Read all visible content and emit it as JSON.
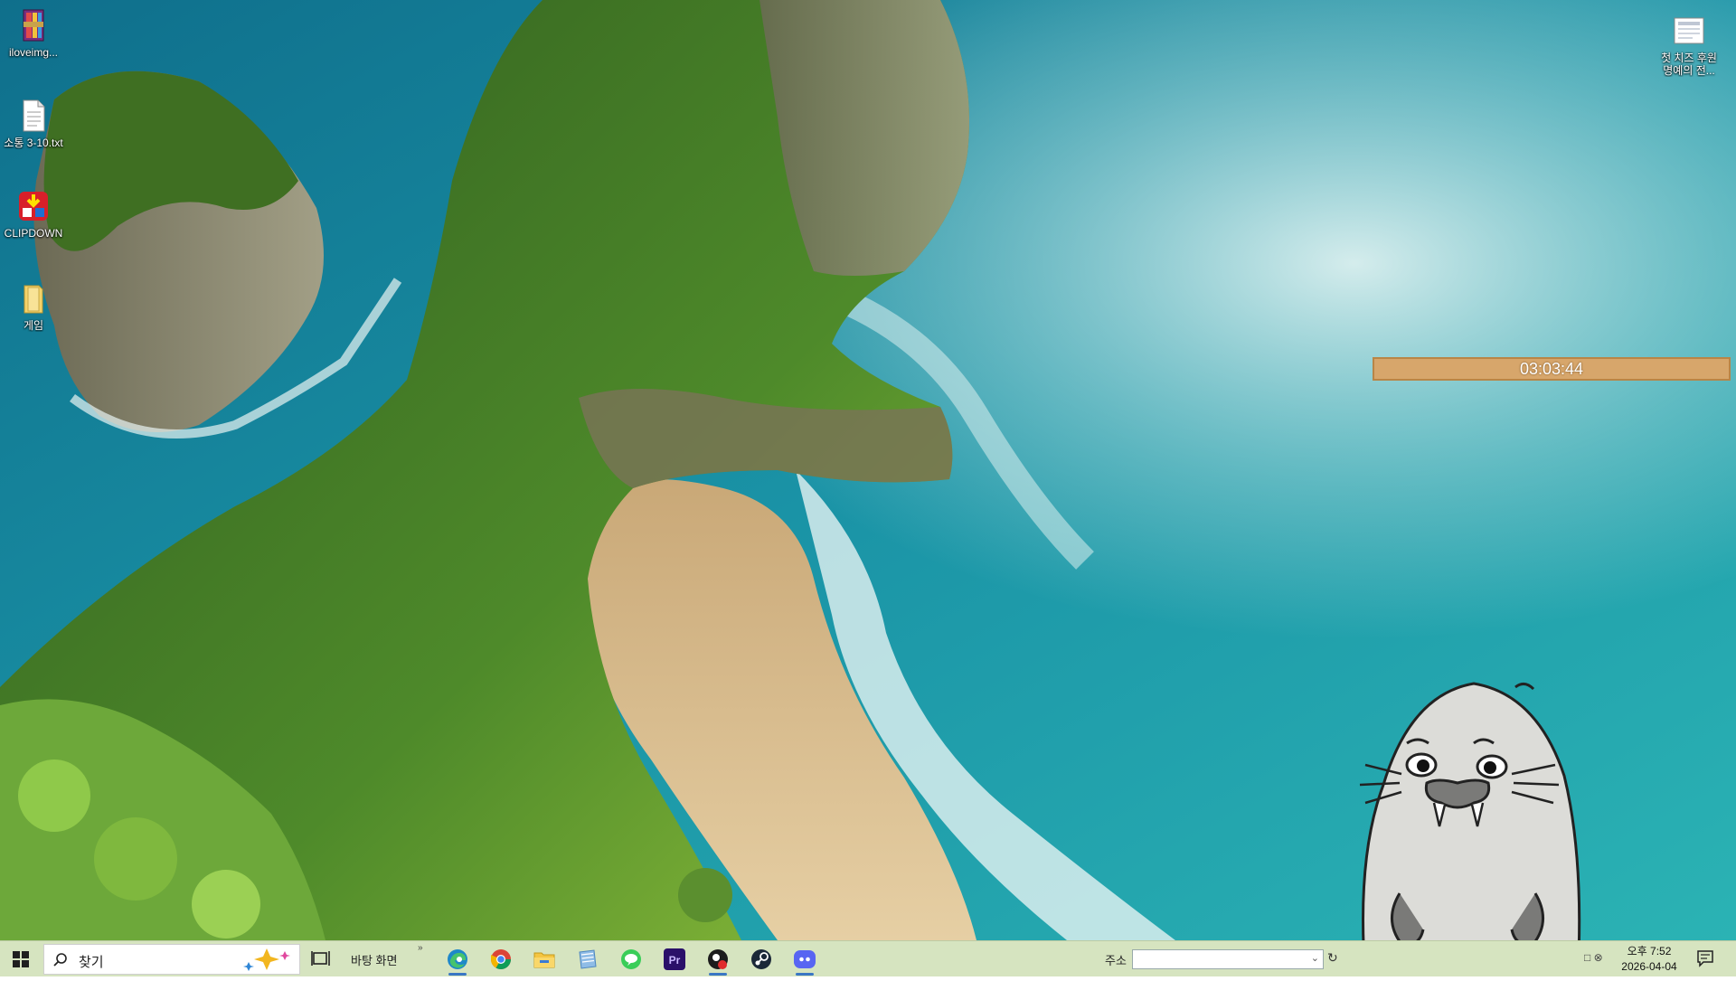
{
  "desktop": {
    "icons": [
      {
        "label": "iloveimg...",
        "icon": "archive-icon"
      },
      {
        "label": "소통 3-10.txt",
        "icon": "text-file-icon"
      },
      {
        "label": "CLIPDOWN",
        "icon": "clipdown-app-icon"
      },
      {
        "label": "게임",
        "icon": "folder-icon"
      }
    ],
    "right_icon": {
      "label_line1": "첫 치즈 후원",
      "label_line2": "명예의 전...",
      "icon": "document-thumbnail-icon"
    }
  },
  "timer": {
    "text": "03:03:44"
  },
  "taskbar": {
    "search_placeholder": "찾기",
    "desktop_label": "바탕 화면",
    "address_label": "주소",
    "address_value": "",
    "apps": [
      {
        "name": "edge",
        "icon": "edge-icon",
        "active": true
      },
      {
        "name": "chrome",
        "icon": "chrome-icon",
        "active": false
      },
      {
        "name": "file-explorer",
        "icon": "folder-icon",
        "active": false
      },
      {
        "name": "notepad",
        "icon": "notepad-icon",
        "active": false
      },
      {
        "name": "line",
        "icon": "line-icon",
        "active": false
      },
      {
        "name": "premiere",
        "icon": "premiere-pro-icon",
        "active": false
      },
      {
        "name": "media-app",
        "icon": "media-app-icon",
        "active": true
      },
      {
        "name": "steam",
        "icon": "steam-icon",
        "active": false
      },
      {
        "name": "discord",
        "icon": "discord-icon",
        "active": true
      }
    ],
    "premiere_label": "Pr",
    "clock_time": "오후 7:52",
    "clock_date": "2026-04-04"
  },
  "colors": {
    "taskbar_bg": "#d6e4c0",
    "timer_bg": "#d7a66b",
    "accent": "#3a77c4"
  }
}
